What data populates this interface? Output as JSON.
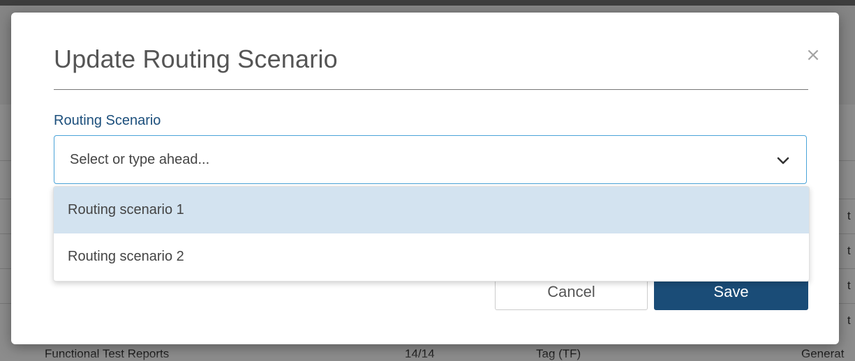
{
  "background": {
    "bottom_row": {
      "name": "Functional Test Reports",
      "count": "14/14",
      "tag": "Tag (TF)",
      "status": "Generat"
    },
    "right_edge_letter": "t"
  },
  "modal": {
    "title": "Update Routing Scenario",
    "close_label": "×",
    "field_label": "Routing Scenario",
    "select": {
      "placeholder": "Select or type ahead..."
    },
    "options": [
      {
        "label": "Routing scenario 1",
        "highlighted": true
      },
      {
        "label": "Routing scenario 2",
        "highlighted": false
      }
    ],
    "cancel_label": "Cancel",
    "save_label": "Save"
  },
  "colors": {
    "accent": "#1a4c77",
    "label": "#1c4f7c",
    "focus_border": "#4aa3d8",
    "option_highlight": "#d3e3f0"
  },
  "icons": {
    "close": "close-icon",
    "chevron": "chevron-down-icon"
  }
}
